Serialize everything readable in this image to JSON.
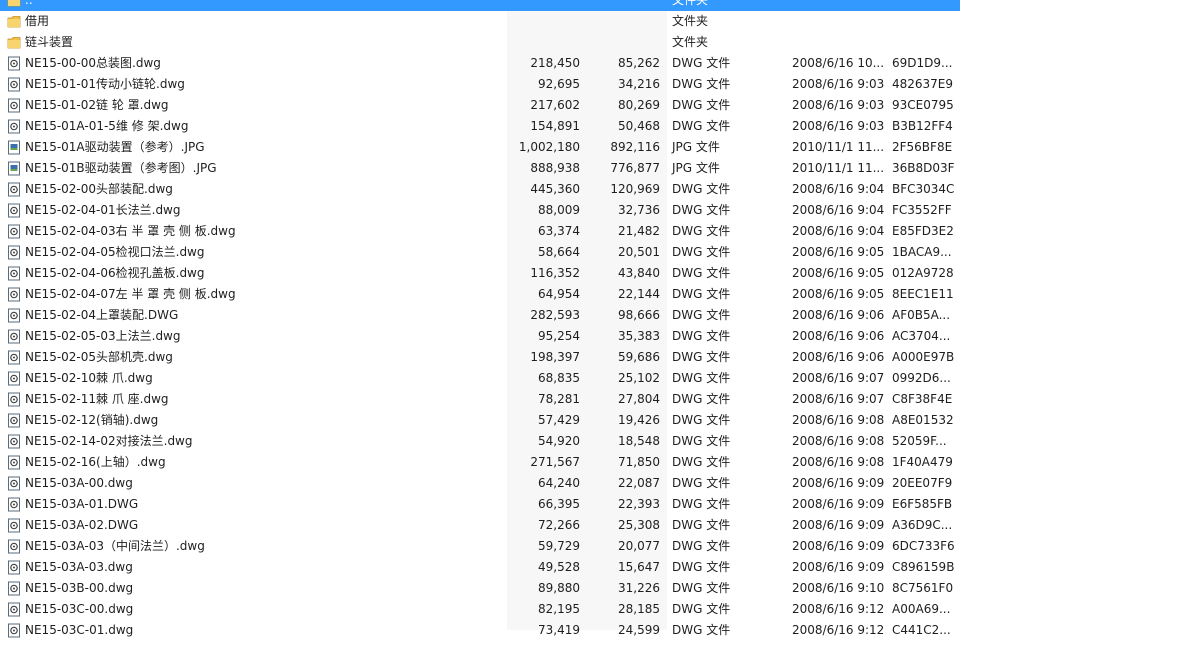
{
  "colors": {
    "selection": "#3399ff",
    "folder": "#f1c04b",
    "file_icon_border": "#5a6b7b"
  },
  "rows": [
    {
      "name": "..",
      "size": "",
      "packed": "",
      "type": "文件夹",
      "date": "",
      "crc": "",
      "icon": "folder-up-icon",
      "selected": true
    },
    {
      "name": "借用",
      "size": "",
      "packed": "",
      "type": "文件夹",
      "date": "",
      "crc": "",
      "icon": "folder-icon"
    },
    {
      "name": "链斗装置",
      "size": "",
      "packed": "",
      "type": "文件夹",
      "date": "",
      "crc": "",
      "icon": "folder-icon"
    },
    {
      "name": "NE15-00-00总装图.dwg",
      "size": "218,450",
      "packed": "85,262",
      "type": "DWG 文件",
      "date": "2008/6/16 10...",
      "crc": "69D1D9...",
      "icon": "dwg-file-icon"
    },
    {
      "name": "NE15-01-01传动小链轮.dwg",
      "size": "92,695",
      "packed": "34,216",
      "type": "DWG 文件",
      "date": "2008/6/16 9:03",
      "crc": "482637E9",
      "icon": "dwg-file-icon"
    },
    {
      "name": "NE15-01-02链 轮 罩.dwg",
      "size": "217,602",
      "packed": "80,269",
      "type": "DWG 文件",
      "date": "2008/6/16 9:03",
      "crc": "93CE0795",
      "icon": "dwg-file-icon"
    },
    {
      "name": "NE15-01A-01-5维 修 架.dwg",
      "size": "154,891",
      "packed": "50,468",
      "type": "DWG 文件",
      "date": "2008/6/16 9:03",
      "crc": "B3B12FF4",
      "icon": "dwg-file-icon"
    },
    {
      "name": "NE15-01A驱动装置（参考）.JPG",
      "size": "1,002,180",
      "packed": "892,116",
      "type": "JPG 文件",
      "date": "2010/11/1 11...",
      "crc": "2F56BF8E",
      "icon": "jpg-file-icon"
    },
    {
      "name": "NE15-01B驱动装置（参考图）.JPG",
      "size": "888,938",
      "packed": "776,877",
      "type": "JPG 文件",
      "date": "2010/11/1 11...",
      "crc": "36B8D03F",
      "icon": "jpg-file-icon"
    },
    {
      "name": "NE15-02-00头部装配.dwg",
      "size": "445,360",
      "packed": "120,969",
      "type": "DWG 文件",
      "date": "2008/6/16 9:04",
      "crc": "BFC3034C",
      "icon": "dwg-file-icon"
    },
    {
      "name": "NE15-02-04-01长法兰.dwg",
      "size": "88,009",
      "packed": "32,736",
      "type": "DWG 文件",
      "date": "2008/6/16 9:04",
      "crc": "FC3552FF",
      "icon": "dwg-file-icon"
    },
    {
      "name": "NE15-02-04-03右 半 罩 壳 侧 板.dwg",
      "size": "63,374",
      "packed": "21,482",
      "type": "DWG 文件",
      "date": "2008/6/16 9:04",
      "crc": "E85FD3E2",
      "icon": "dwg-file-icon"
    },
    {
      "name": "NE15-02-04-05检视口法兰.dwg",
      "size": "58,664",
      "packed": "20,501",
      "type": "DWG 文件",
      "date": "2008/6/16 9:05",
      "crc": "1BACA9...",
      "icon": "dwg-file-icon"
    },
    {
      "name": "NE15-02-04-06检视孔盖板.dwg",
      "size": "116,352",
      "packed": "43,840",
      "type": "DWG 文件",
      "date": "2008/6/16 9:05",
      "crc": "012A9728",
      "icon": "dwg-file-icon"
    },
    {
      "name": "NE15-02-04-07左 半 罩 壳 侧 板.dwg",
      "size": "64,954",
      "packed": "22,144",
      "type": "DWG 文件",
      "date": "2008/6/16 9:05",
      "crc": "8EEC1E11",
      "icon": "dwg-file-icon"
    },
    {
      "name": "NE15-02-04上罩装配.DWG",
      "size": "282,593",
      "packed": "98,666",
      "type": "DWG 文件",
      "date": "2008/6/16 9:06",
      "crc": "AF0B5A...",
      "icon": "dwg-file-icon"
    },
    {
      "name": "NE15-02-05-03上法兰.dwg",
      "size": "95,254",
      "packed": "35,383",
      "type": "DWG 文件",
      "date": "2008/6/16 9:06",
      "crc": "AC3704...",
      "icon": "dwg-file-icon"
    },
    {
      "name": "NE15-02-05头部机壳.dwg",
      "size": "198,397",
      "packed": "59,686",
      "type": "DWG 文件",
      "date": "2008/6/16 9:06",
      "crc": "A000E97B",
      "icon": "dwg-file-icon"
    },
    {
      "name": "NE15-02-10棘  爪.dwg",
      "size": "68,835",
      "packed": "25,102",
      "type": "DWG 文件",
      "date": "2008/6/16 9:07",
      "crc": "0992D6...",
      "icon": "dwg-file-icon"
    },
    {
      "name": "NE15-02-11棘 爪 座.dwg",
      "size": "78,281",
      "packed": "27,804",
      "type": "DWG 文件",
      "date": "2008/6/16 9:07",
      "crc": "C8F38F4E",
      "icon": "dwg-file-icon"
    },
    {
      "name": "NE15-02-12(销轴).dwg",
      "size": "57,429",
      "packed": "19,426",
      "type": "DWG 文件",
      "date": "2008/6/16 9:08",
      "crc": "A8E01532",
      "icon": "dwg-file-icon"
    },
    {
      "name": "NE15-02-14-02对接法兰.dwg",
      "size": "54,920",
      "packed": "18,548",
      "type": "DWG 文件",
      "date": "2008/6/16 9:08",
      "crc": "52059F...",
      "icon": "dwg-file-icon"
    },
    {
      "name": "NE15-02-16(上轴）.dwg",
      "size": "271,567",
      "packed": "71,850",
      "type": "DWG 文件",
      "date": "2008/6/16 9:08",
      "crc": "1F40A479",
      "icon": "dwg-file-icon"
    },
    {
      "name": "NE15-03A-00.dwg",
      "size": "64,240",
      "packed": "22,087",
      "type": "DWG 文件",
      "date": "2008/6/16 9:09",
      "crc": "20EE07F9",
      "icon": "dwg-file-icon"
    },
    {
      "name": "NE15-03A-01.DWG",
      "size": "66,395",
      "packed": "22,393",
      "type": "DWG 文件",
      "date": "2008/6/16 9:09",
      "crc": "E6F585FB",
      "icon": "dwg-file-icon"
    },
    {
      "name": "NE15-03A-02.DWG",
      "size": "72,266",
      "packed": "25,308",
      "type": "DWG 文件",
      "date": "2008/6/16 9:09",
      "crc": "A36D9C...",
      "icon": "dwg-file-icon"
    },
    {
      "name": "NE15-03A-03（中间法兰）.dwg",
      "size": "59,729",
      "packed": "20,077",
      "type": "DWG 文件",
      "date": "2008/6/16 9:09",
      "crc": "6DC733F6",
      "icon": "dwg-file-icon"
    },
    {
      "name": "NE15-03A-03.dwg",
      "size": "49,528",
      "packed": "15,647",
      "type": "DWG 文件",
      "date": "2008/6/16 9:09",
      "crc": "C896159B",
      "icon": "dwg-file-icon"
    },
    {
      "name": "NE15-03B-00.dwg",
      "size": "89,880",
      "packed": "31,226",
      "type": "DWG 文件",
      "date": "2008/6/16 9:10",
      "crc": "8C7561F0",
      "icon": "dwg-file-icon"
    },
    {
      "name": "NE15-03C-00.dwg",
      "size": "82,195",
      "packed": "28,185",
      "type": "DWG 文件",
      "date": "2008/6/16 9:12",
      "crc": "A00A69...",
      "icon": "dwg-file-icon"
    },
    {
      "name": "NE15-03C-01.dwg",
      "size": "73,419",
      "packed": "24,599",
      "type": "DWG 文件",
      "date": "2008/6/16 9:12",
      "crc": "C441C2...",
      "icon": "dwg-file-icon"
    }
  ]
}
